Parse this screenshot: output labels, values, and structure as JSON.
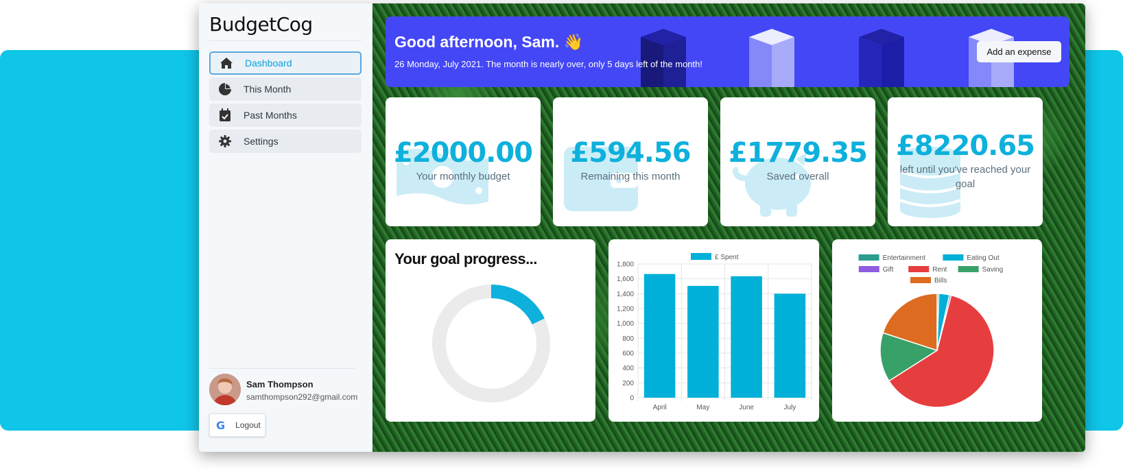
{
  "app": {
    "logo": "BudgetCog"
  },
  "sidebar": {
    "items": [
      {
        "label": "Dashboard",
        "icon": "home-icon",
        "active": true
      },
      {
        "label": "This Month",
        "icon": "pie-chart-icon",
        "active": false
      },
      {
        "label": "Past Months",
        "icon": "calendar-check-icon",
        "active": false
      },
      {
        "label": "Settings",
        "icon": "gear-icon",
        "active": false
      }
    ],
    "user": {
      "name": "Sam Thompson",
      "email": "samthompson292@gmail.com"
    },
    "logout_label": "Logout"
  },
  "banner": {
    "greeting": "Good afternoon, Sam. 👋",
    "subtitle": "26 Monday, July 2021. The month is nearly over, only 5 days left of the month!",
    "button_label": "Add an expense"
  },
  "stats": [
    {
      "value": "£2000.00",
      "label": "Your monthly budget",
      "icon": "money-bill-icon"
    },
    {
      "value": "£594.56",
      "label": "Remaining this month",
      "icon": "wallet-icon"
    },
    {
      "value": "£1779.35",
      "label": "Saved overall",
      "icon": "piggy-bank-icon"
    },
    {
      "value": "£8220.65",
      "label": "left until you've reached your goal",
      "icon": "coins-icon"
    }
  ],
  "goal": {
    "title": "Your goal progress...",
    "progress": 0.18,
    "colors": {
      "progress": "#0eb0dc",
      "track": "#ebebeb"
    }
  },
  "chart_data": [
    {
      "type": "bar",
      "categories": [
        "April",
        "May",
        "June",
        "July"
      ],
      "series": [
        {
          "name": "£ Spent",
          "values": [
            1665,
            1505,
            1635,
            1400
          ],
          "color": "#00b0d8"
        }
      ],
      "ylim": [
        0,
        1800
      ],
      "yticks": [
        "0",
        "200",
        "400",
        "600",
        "800",
        "1,000",
        "1,200",
        "1,400",
        "1,600",
        "1,800"
      ],
      "grid": true,
      "legend": "top"
    },
    {
      "type": "pie",
      "labels": [
        "Entertainment",
        "Eating Out",
        "Gift",
        "Rent",
        "Saving",
        "Bills"
      ],
      "values": [
        0.5,
        3,
        0.5,
        62,
        14,
        20
      ],
      "colors": [
        "#2a9d8f",
        "#00b0d8",
        "#8f5ce0",
        "#e63e3e",
        "#38a169",
        "#dd6b20"
      ],
      "legend": "top"
    }
  ]
}
